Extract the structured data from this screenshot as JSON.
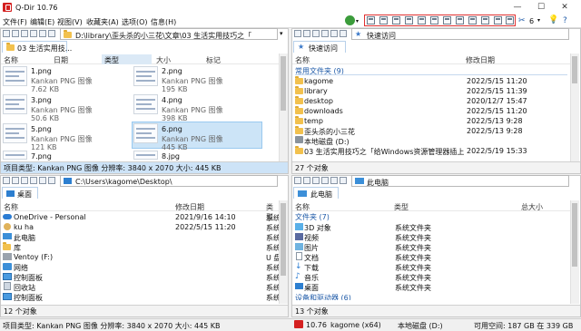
{
  "app": {
    "title": "Q-Dir 10.76"
  },
  "menu": [
    "文件(F)",
    "编辑(E)",
    "视图(V)",
    "收藏夹(A)",
    "选项(O)",
    "信息(H)"
  ],
  "toolbar": {
    "count_label": "6"
  },
  "window_buttons": {
    "min": "—",
    "max": "☐",
    "close": "✕"
  },
  "pane_tl": {
    "address": "D:\\library\\歪头杀的小三花\\文章\\03 生活实用技巧之「",
    "tab": "03 生活实用技...",
    "headers": [
      "名称",
      "日期",
      "类型",
      "大小",
      "标记"
    ],
    "files": [
      {
        "name": "1.png",
        "type": "Kankan PNG 图像",
        "size": "7.62 KB"
      },
      {
        "name": "2.png",
        "type": "Kankan PNG 图像",
        "size": "195 KB"
      },
      {
        "name": "3.png",
        "type": "Kankan PNG 图像",
        "size": "50.6 KB"
      },
      {
        "name": "4.png",
        "type": "Kankan PNG 图像",
        "size": "398 KB"
      },
      {
        "name": "5.png",
        "type": "Kankan PNG 图像",
        "size": "121 KB"
      },
      {
        "name": "6.png",
        "type": "Kankan PNG 图像",
        "size": "445 KB"
      },
      {
        "name": "7.png"
      },
      {
        "name": "8.jpg"
      }
    ],
    "status": "项目类型: Kankan PNG 图像 分辨率: 3840 x 2070 大小: 445 KB"
  },
  "pane_tr": {
    "address": "快速访问",
    "tab": "快速访问",
    "headers": [
      "名称",
      "修改日期"
    ],
    "group": "常用文件夹 (9)",
    "rows": [
      {
        "name": "kagome",
        "date": "2022/5/15 11:20"
      },
      {
        "name": "library",
        "date": "2022/5/15 11:39"
      },
      {
        "name": "desktop",
        "date": "2020/12/7 15:47"
      },
      {
        "name": "downloads",
        "date": "2022/5/15 11:20"
      },
      {
        "name": "temp",
        "date": "2022/5/13 9:28"
      },
      {
        "name": "歪头杀的小三花",
        "date": "2022/5/13 9:28"
      },
      {
        "name": "本地磁盘 (D:)",
        "date": ""
      },
      {
        "name": "03 生活实用技巧之「给Windows资源管理器插上翅",
        "date": "2022/5/19 15:33"
      }
    ],
    "status": "27 个对象"
  },
  "pane_bl": {
    "address": "C:\\Users\\kagome\\Desktop\\",
    "tab": "桌面",
    "headers": [
      "名称",
      "修改日期",
      "类型"
    ],
    "rows": [
      {
        "name": "OneDrive - Personal",
        "date": "2021/9/16 14:10",
        "type": "系统"
      },
      {
        "name": "ku ha",
        "date": "2022/5/15 11:20",
        "type": "系统"
      },
      {
        "name": "此电脑",
        "date": "",
        "type": "系统"
      },
      {
        "name": "库",
        "date": "",
        "type": "系统"
      },
      {
        "name": "Ventoy (F:)",
        "date": "",
        "type": "U 盘"
      },
      {
        "name": "网络",
        "date": "",
        "type": "系统"
      },
      {
        "name": "控制面板",
        "date": "",
        "type": "系统"
      },
      {
        "name": "回收站",
        "date": "",
        "type": "系统"
      },
      {
        "name": "控制面板",
        "date": "",
        "type": "系统"
      }
    ],
    "status": "12 个对象"
  },
  "pane_br": {
    "address": "此电脑",
    "tab": "此电脑",
    "headers": [
      "名称",
      "类型",
      "总大小"
    ],
    "group": "文件夹 (7)",
    "rows": [
      {
        "name": "3D 对象",
        "type": "系统文件夹"
      },
      {
        "name": "视频",
        "type": "系统文件夹"
      },
      {
        "name": "图片",
        "type": "系统文件夹"
      },
      {
        "name": "文档",
        "type": "系统文件夹"
      },
      {
        "name": "下载",
        "type": "系统文件夹"
      },
      {
        "name": "音乐",
        "type": "系统文件夹"
      },
      {
        "name": "桌面",
        "type": "系统文件夹"
      }
    ],
    "group2": "设备和驱动器 (6)",
    "status": "13 个对象"
  },
  "bottom_status": {
    "left": "项目类型: Kankan PNG 图像 分辨率: 3840 x 2070 大小: 445 KB",
    "version": "10.76",
    "user": "kagome (x64)",
    "drive": "本地磁盘 (D:)",
    "free": "可用空间: 187 GB 在 339 GB"
  }
}
